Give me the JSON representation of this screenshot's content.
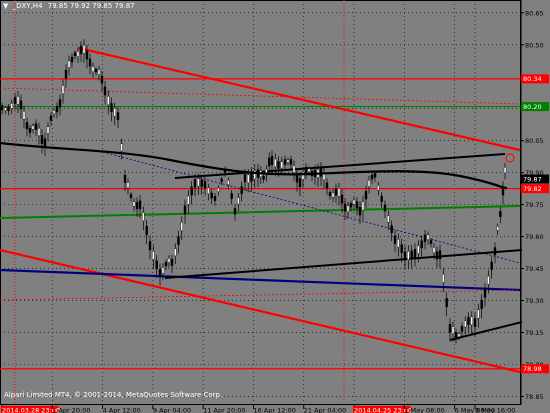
{
  "header": {
    "symbol": "_DXY,H4",
    "ohlc": "79.85 79.92 79.85 79.87",
    "arrow": "▼"
  },
  "copyright": "Alpari Limited MT4, © 2001-2014, MetaQuotes Software Corp.",
  "price_axis": {
    "ticks": [
      {
        "label": "80.65",
        "v": 80.65
      },
      {
        "label": "80.50",
        "v": 80.5
      },
      {
        "label": "80.20",
        "v": 80.2
      },
      {
        "label": "80.05",
        "v": 80.05
      },
      {
        "label": "79.90",
        "v": 79.9
      },
      {
        "label": "79.75",
        "v": 79.75
      },
      {
        "label": "79.60",
        "v": 79.6
      },
      {
        "label": "79.45",
        "v": 79.45
      },
      {
        "label": "79.30",
        "v": 79.3
      },
      {
        "label": "79.15",
        "v": 79.15
      },
      {
        "label": "79.00",
        "v": 79.0
      },
      {
        "label": "78.85",
        "v": 78.85
      }
    ],
    "range": [
      78.81,
      80.71
    ]
  },
  "price_tags": [
    {
      "label": "80.34",
      "v": 80.34,
      "color": "#ff0000"
    },
    {
      "label": "80.20",
      "v": 80.21,
      "color": "#008000"
    },
    {
      "label": "79.87",
      "v": 79.87,
      "color": "#000000"
    },
    {
      "label": "79.82",
      "v": 79.825,
      "color": "#ff0000"
    },
    {
      "label": "78.98",
      "v": 78.98,
      "color": "#ff0000"
    }
  ],
  "time_axis": {
    "labels": [
      {
        "label": "2014.03.28 23:00",
        "highlight": true
      },
      {
        "label": "1 Apr 20:00",
        "highlight": false
      },
      {
        "label": "4 Apr 12:00",
        "highlight": false
      },
      {
        "label": "9 Apr 04:00",
        "highlight": false
      },
      {
        "label": "11 Apr 20:00",
        "highlight": false
      },
      {
        "label": "16 Apr 12:00",
        "highlight": false
      },
      {
        "label": "21 Apr 04:00",
        "highlight": false
      },
      {
        "label": "2014.04.25 23:00",
        "highlight": true
      },
      {
        "label": "1 May 08:00",
        "highlight": false
      },
      {
        "label": "6 May 00:00",
        "highlight": false
      },
      {
        "label": "8 May 16:00",
        "highlight": false
      }
    ]
  },
  "colors": {
    "background": "#808080",
    "grid": "#000000",
    "candles": "#000000",
    "resistance": "#ff0000",
    "support_green": "#008000",
    "support_blue": "#000080"
  }
}
